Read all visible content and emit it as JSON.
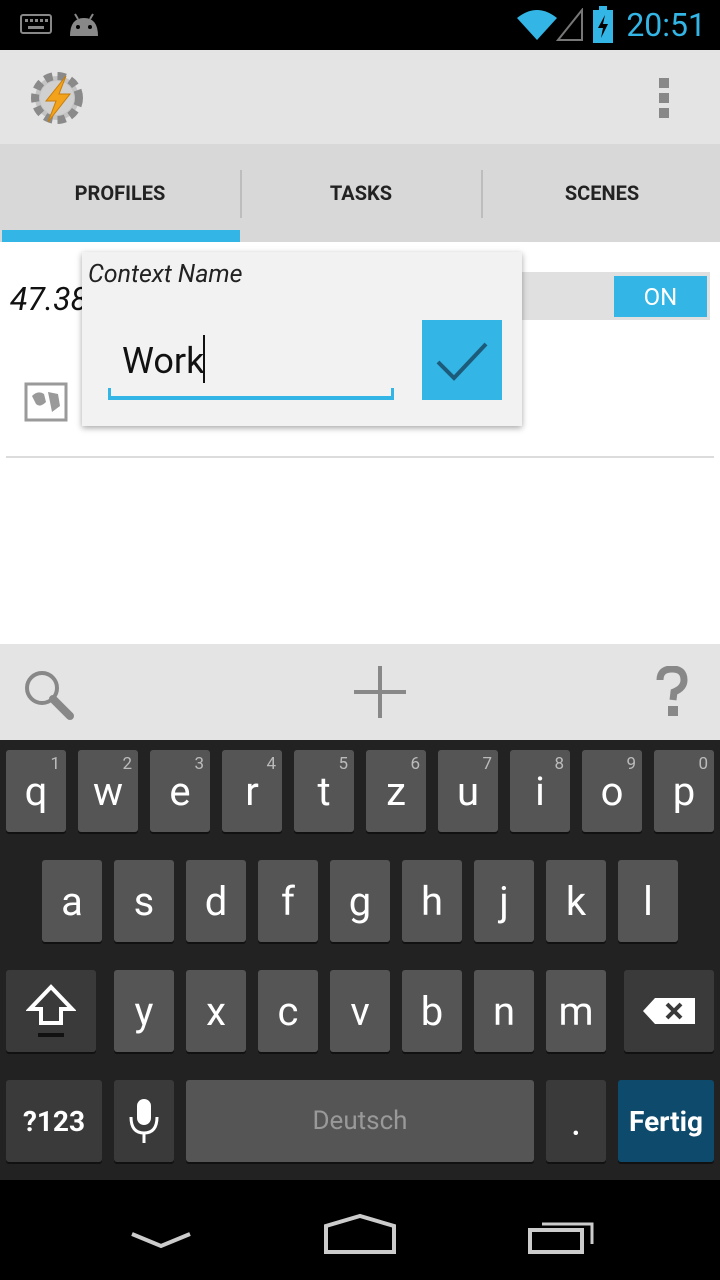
{
  "status_bar": {
    "time": "20:51"
  },
  "tabs": [
    {
      "label": "PROFILES"
    },
    {
      "label": "TASKS"
    },
    {
      "label": "SCENES"
    }
  ],
  "profile": {
    "partial_text": "47.38",
    "toggle_label": "ON"
  },
  "dialog": {
    "title": "Context Name",
    "input_value": "Work"
  },
  "keyboard": {
    "row1": [
      {
        "label": "q",
        "hint": "1"
      },
      {
        "label": "w",
        "hint": "2"
      },
      {
        "label": "e",
        "hint": "3"
      },
      {
        "label": "r",
        "hint": "4"
      },
      {
        "label": "t",
        "hint": "5"
      },
      {
        "label": "z",
        "hint": "6"
      },
      {
        "label": "u",
        "hint": "7"
      },
      {
        "label": "i",
        "hint": "8"
      },
      {
        "label": "o",
        "hint": "9"
      },
      {
        "label": "p",
        "hint": "0"
      }
    ],
    "row2": [
      "a",
      "s",
      "d",
      "f",
      "g",
      "h",
      "j",
      "k",
      "l"
    ],
    "row3": [
      "y",
      "x",
      "c",
      "v",
      "b",
      "n",
      "m"
    ],
    "numbers_label": "?123",
    "space_label": "Deutsch",
    "period_label": ".",
    "done_label": "Fertig"
  },
  "colors": {
    "accent": "#33b5e5",
    "key": "#555555",
    "keyboard_bg": "#222222",
    "done_key": "#0e4a6b"
  }
}
